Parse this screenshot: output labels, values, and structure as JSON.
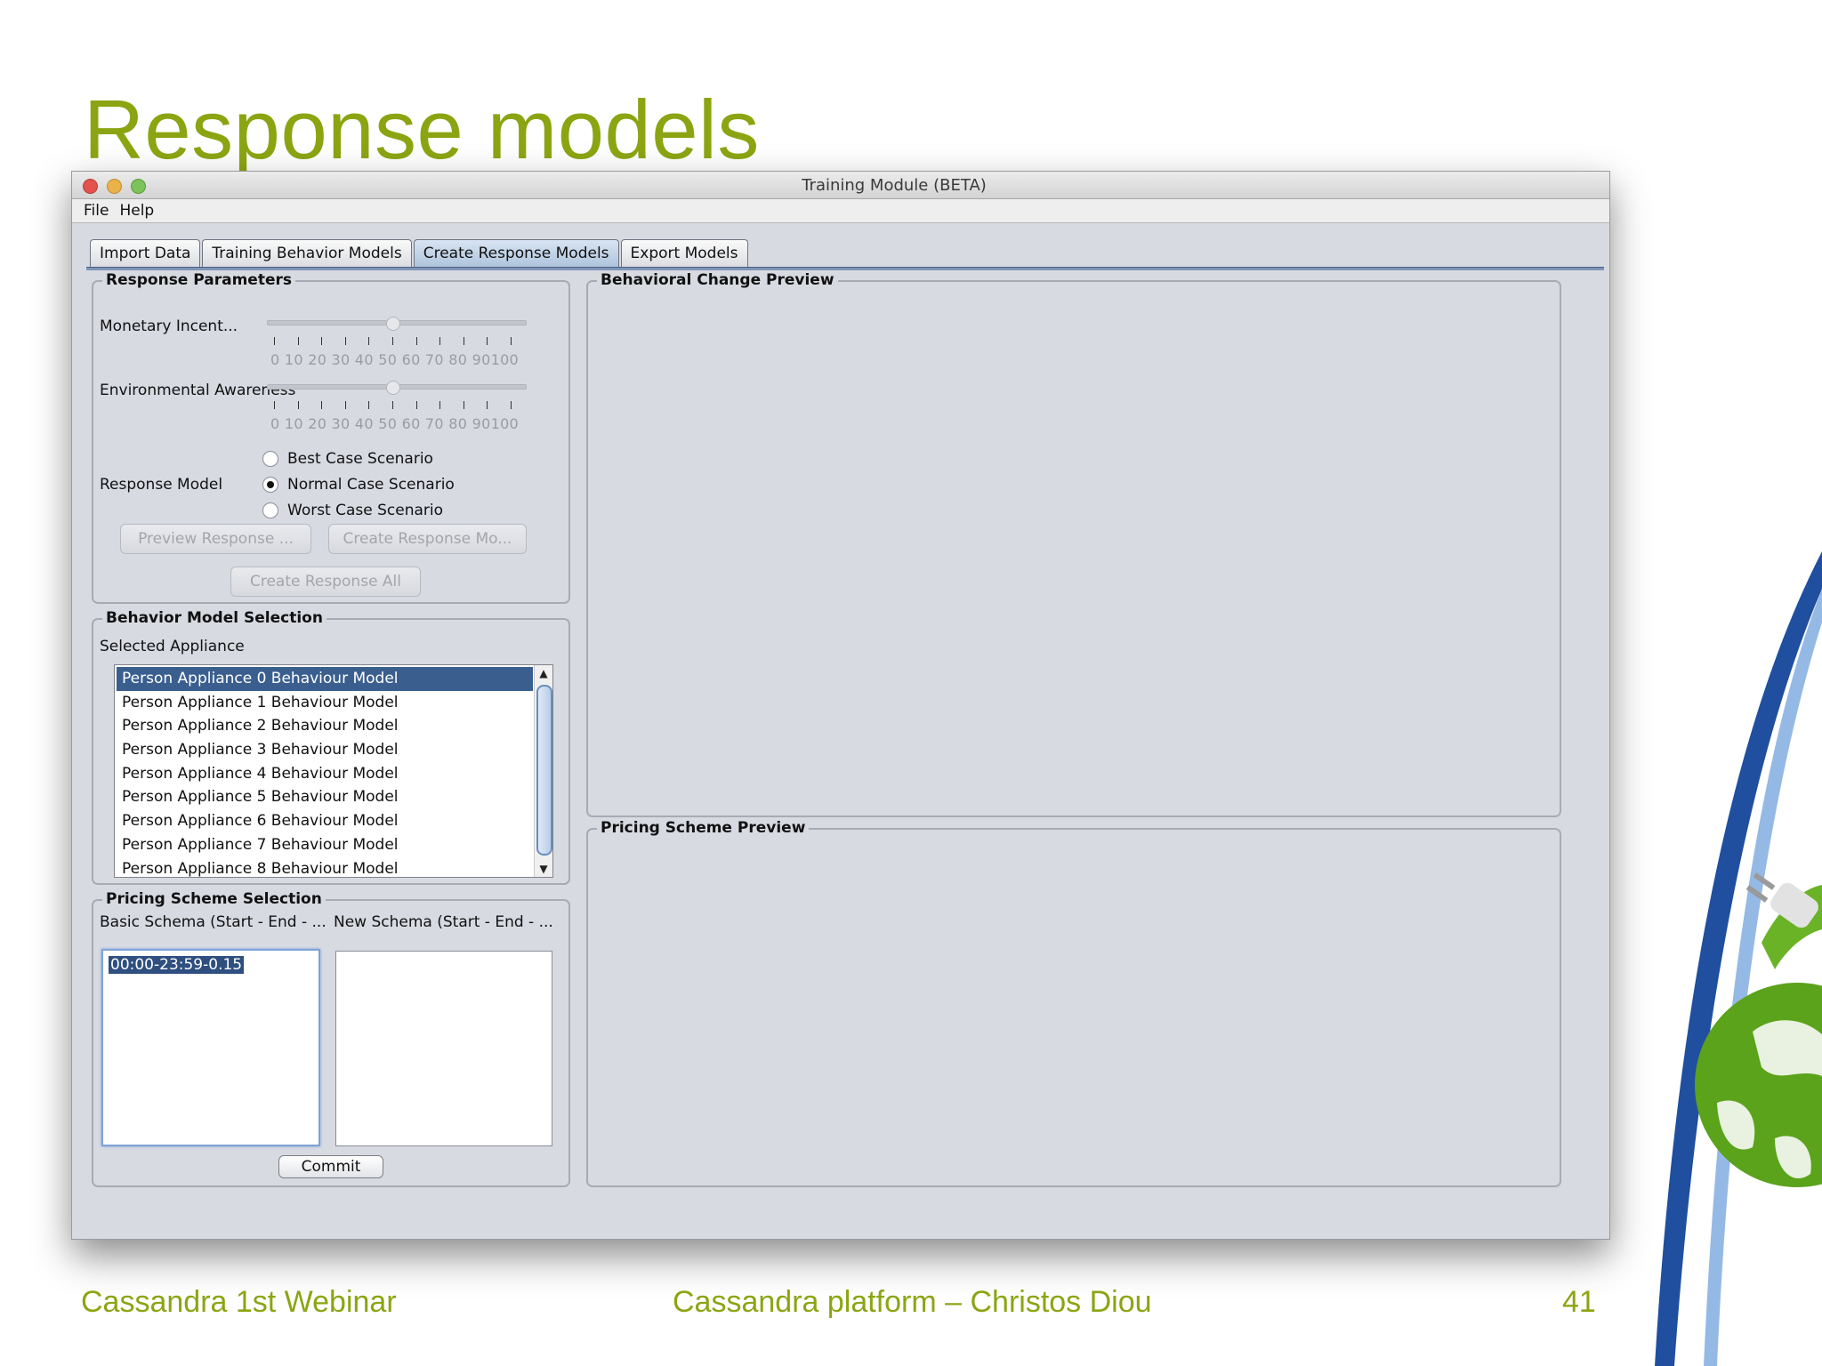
{
  "slide": {
    "title": "Response models",
    "footer_left": "Cassandra 1st Webinar",
    "footer_center": "Cassandra platform – Christos Diou",
    "page_number": "41"
  },
  "window": {
    "title": "Training Module (BETA)",
    "menu": [
      "File",
      "Help"
    ],
    "tabs": [
      {
        "label": "Import Data",
        "active": false
      },
      {
        "label": "Training Behavior Models",
        "active": false
      },
      {
        "label": "Create Response Models",
        "active": true
      },
      {
        "label": "Export Models",
        "active": false
      }
    ]
  },
  "response_parameters": {
    "title": "Response Parameters",
    "monetary_label": "Monetary Incent...",
    "monetary_value": 50,
    "environmental_label": "Environmental Awareness",
    "environmental_value": 50,
    "tick_labels": "0  10 20 30 40 50 60 70 80 90100",
    "response_model_label": "Response Model",
    "options": [
      "Best Case Scenario",
      "Normal Case Scenario",
      "Worst Case Scenario"
    ],
    "selected_option": "Normal Case Scenario",
    "preview_button": "Preview Response ...",
    "create_button": "Create Response Mo...",
    "create_all_button": "Create Response All"
  },
  "behavior_model_selection": {
    "title": "Behavior Model Selection",
    "selected_appliance_label": "Selected Appliance",
    "items": [
      "Person Appliance 0 Behaviour Model",
      "Person Appliance 1 Behaviour Model",
      "Person Appliance 2 Behaviour Model",
      "Person Appliance 3 Behaviour Model",
      "Person Appliance 4 Behaviour Model",
      "Person Appliance 5 Behaviour Model",
      "Person Appliance 6 Behaviour Model",
      "Person Appliance 7 Behaviour Model",
      "Person Appliance 8 Behaviour Model"
    ],
    "selected_index": 0
  },
  "pricing_scheme_selection": {
    "title": "Pricing Scheme Selection",
    "basic_label": "Basic Schema (Start - End - ...",
    "new_label": "New Schema (Start - End - ...",
    "basic_value": "00:00-23:59-0.15",
    "new_value": "",
    "commit_button": "Commit"
  },
  "previews": {
    "behavioral_title": "Behavioral Change Preview",
    "pricing_title": "Pricing Scheme Preview"
  }
}
